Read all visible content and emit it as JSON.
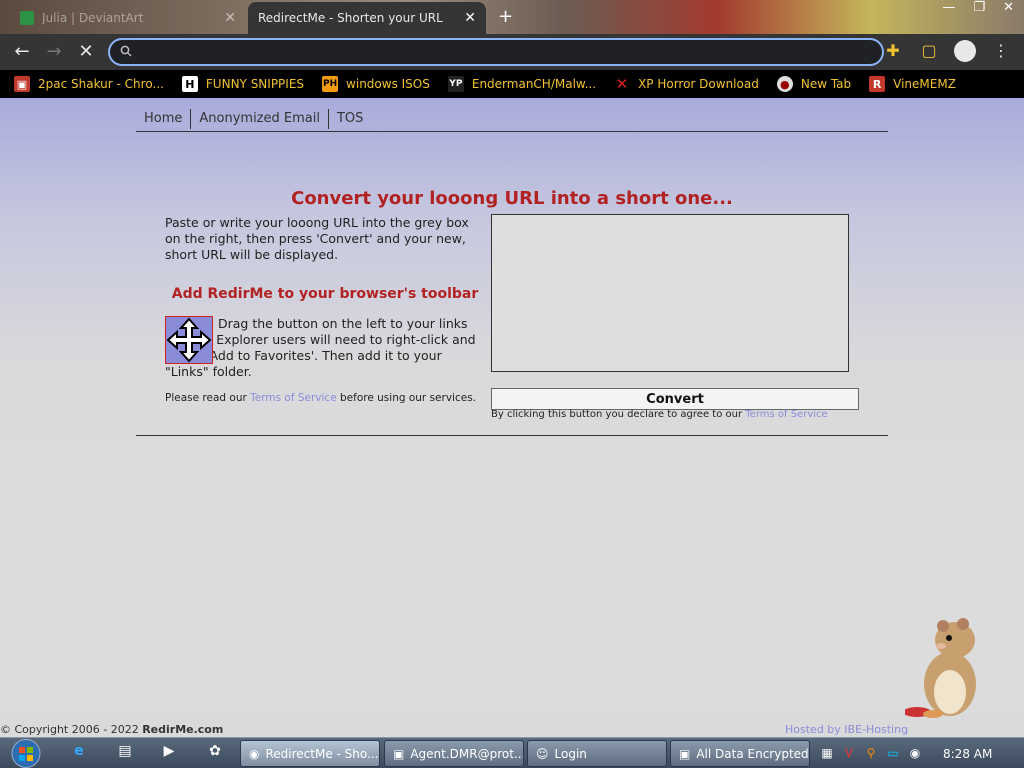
{
  "browser": {
    "tabs": [
      {
        "title": "Julia | DeviantArt",
        "active": false
      },
      {
        "title": "RedirectMe - Shorten your URL",
        "active": true
      }
    ],
    "new_tab_symbol": "+",
    "omnibox": {
      "value": "",
      "placeholder": ""
    },
    "bookmarks": [
      {
        "label": "2pac Shakur - Chro...",
        "icon": "briefcase"
      },
      {
        "label": "FUNNY SNIPPIES",
        "icon": "H"
      },
      {
        "label": "windows ISOS",
        "icon": "PH"
      },
      {
        "label": "EndermanCH/Malw...",
        "icon": "YP"
      },
      {
        "label": "XP Horror Download",
        "icon": "X"
      },
      {
        "label": "New Tab",
        "icon": "globe"
      },
      {
        "label": "VineMEMZ",
        "icon": "R"
      }
    ]
  },
  "page": {
    "nav": [
      {
        "label": "Home"
      },
      {
        "label": "Anonymized Email"
      },
      {
        "label": "TOS"
      }
    ],
    "heading": "Convert your looong URL into a short one...",
    "instructions": "Paste or write your looong URL into the grey box on the right, then press 'Convert' and your new, short URL will be displayed.",
    "toolbar_heading": "Add RedirMe to your browser's toolbar",
    "drag_instructions": "Drag the button on the left to your links toolbar. Explorer users will need to right-click and select 'Add to Favorites'. Then add it to your \"Links\" folder.",
    "read_before": "Please read our",
    "tos_link": "Terms of Service",
    "read_after": "before using our services.",
    "url_box_value": "",
    "convert_label": "Convert",
    "declare_text": "By clicking this button you declare to agree to our",
    "copyright_prefix": "© Copyright 2006 - 2022",
    "copyright_site": "RedirMe.com",
    "hosted_text": "Hosted by IBE-Hosting"
  },
  "taskbar": {
    "buttons": [
      {
        "label": "RedirectMe - Sho...",
        "active": true
      },
      {
        "label": "Agent.DMR@prot...",
        "active": false
      },
      {
        "label": "Login",
        "active": false
      },
      {
        "label": "All Data Encrypted",
        "active": false
      }
    ],
    "clock": "8:28 AM"
  },
  "colors": {
    "accent_red": "#b22222",
    "link_blue": "#8a8cd8",
    "omnibox_focus": "#8ab4f8"
  }
}
